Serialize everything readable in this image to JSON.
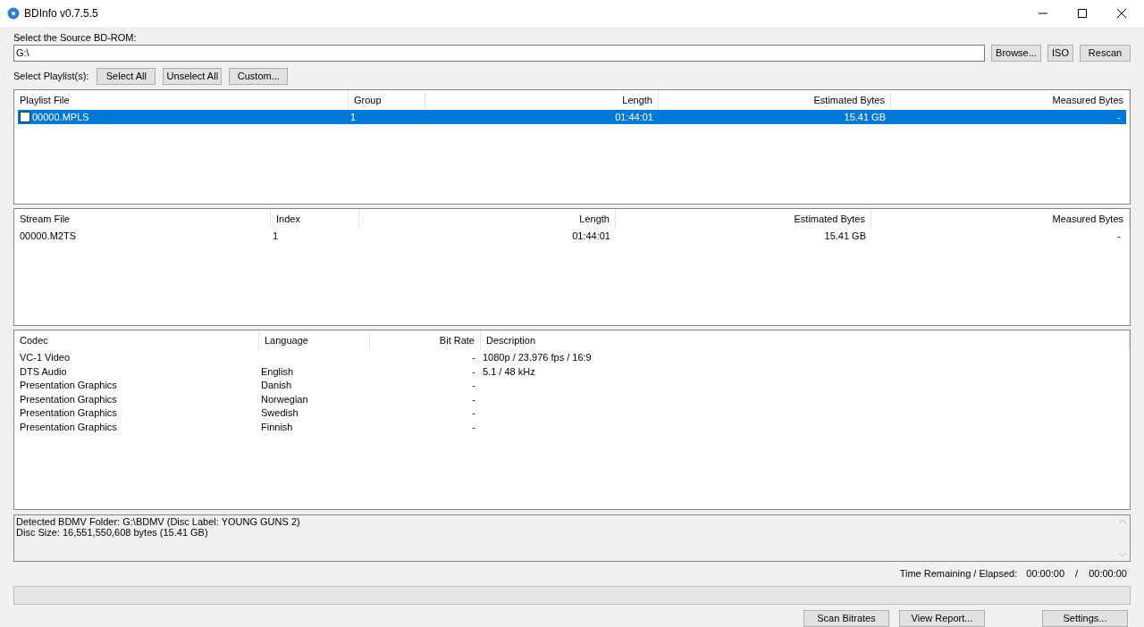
{
  "window": {
    "title": "BDInfo v0.7.5.5"
  },
  "source": {
    "label": "Select the Source BD-ROM:",
    "value": "G:\\",
    "buttons": [
      "Browse...",
      "ISO",
      "Rescan"
    ]
  },
  "playlist_select": {
    "label": "Select Playlist(s):",
    "buttons": [
      "Select All",
      "Unselect All",
      "Custom..."
    ]
  },
  "playlists": {
    "columns": [
      "Playlist File",
      "Group",
      "Length",
      "Estimated Bytes",
      "Measured Bytes"
    ],
    "rows": [
      {
        "cells": [
          "00000.MPLS",
          "1",
          "01:44:01",
          "15.41 GB",
          "-"
        ],
        "checked": false,
        "selected": true
      }
    ]
  },
  "streams": {
    "columns": [
      "Stream File",
      "Index",
      "Length",
      "Estimated Bytes",
      "Measured Bytes"
    ],
    "rows": [
      {
        "cells": [
          "00000.M2TS",
          "1",
          "01:44:01",
          "15.41 GB",
          "-"
        ]
      }
    ]
  },
  "codecs": {
    "columns": [
      "Codec",
      "Language",
      "Bit Rate",
      "Description"
    ],
    "rows": [
      {
        "cells": [
          "VC-1 Video",
          "",
          "-",
          "1080p / 23.976 fps / 16:9"
        ]
      },
      {
        "cells": [
          "DTS Audio",
          "English",
          "-",
          "5.1 / 48 kHz"
        ]
      },
      {
        "cells": [
          "Presentation Graphics",
          "Danish",
          "-",
          ""
        ]
      },
      {
        "cells": [
          "Presentation Graphics",
          "Norwegian",
          "-",
          ""
        ]
      },
      {
        "cells": [
          "Presentation Graphics",
          "Swedish",
          "-",
          ""
        ]
      },
      {
        "cells": [
          "Presentation Graphics",
          "Finnish",
          "-",
          ""
        ]
      }
    ]
  },
  "log": [
    "Detected BDMV Folder: G:\\BDMV (Disc Label: YOUNG GUNS 2)",
    "Disc Size: 16,551,550,608 bytes (15.41 GB)"
  ],
  "time": {
    "label": "Time Remaining / Elapsed:",
    "remaining": "00:00:00",
    "separator": "/",
    "elapsed": "00:00:00"
  },
  "progress": {
    "level": 0
  },
  "bottom_buttons": [
    "Scan Bitrates",
    "View Report...",
    "Settings..."
  ]
}
